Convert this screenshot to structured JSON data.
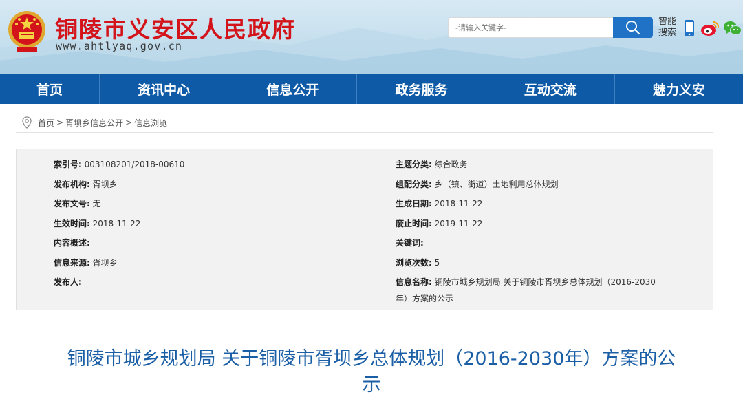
{
  "header": {
    "title": "铜陵市义安区人民政府",
    "url": "www.ahtlyaq.gov.cn",
    "search_placeholder": "-请输入关键字-",
    "smart_search_line1": "智能",
    "smart_search_line2": "搜索",
    "colors": {
      "title_red": "#d4141b",
      "search_blue": "#1f72c6"
    }
  },
  "nav": {
    "items": [
      "首页",
      "资讯中心",
      "信息公开",
      "政务服务",
      "互动交流",
      "魅力义安"
    ],
    "color": "#0e5aa7"
  },
  "breadcrumb": {
    "items": [
      "首页",
      "胥坝乡信息公开",
      "信息浏览"
    ],
    "separator": ">"
  },
  "meta": {
    "left": [
      {
        "key": "索引号:",
        "value": "003108201/2018-00610"
      },
      {
        "key": "发布机构:",
        "value": "胥坝乡"
      },
      {
        "key": "发布文号:",
        "value": "无"
      },
      {
        "key": "生效时间:",
        "value": "2018-11-22"
      },
      {
        "key": "内容概述:",
        "value": ""
      },
      {
        "key": "信息来源:",
        "value": "胥坝乡"
      },
      {
        "key": "发布人:",
        "value": ""
      }
    ],
    "right": [
      {
        "key": "主题分类:",
        "value": "综合政务"
      },
      {
        "key": "组配分类:",
        "value": "乡（镇、街道）土地利用总体规划"
      },
      {
        "key": "生成日期:",
        "value": "2018-11-22"
      },
      {
        "key": "废止时间:",
        "value": "2019-11-22"
      },
      {
        "key": "关键词:",
        "value": ""
      },
      {
        "key": "浏览次数:",
        "value": "5"
      }
    ],
    "name_key": "信息名称:",
    "name_value": "铜陵市城乡规划局 关于铜陵市胥坝乡总体规划（2016-2030年）方案的公示"
  },
  "article": {
    "title_line1": "铜陵市城乡规划局 关于铜陵市胥坝乡总体规划（2016-2030年）方案的公",
    "title_line2": "示",
    "title_color": "#1a5ea6"
  },
  "icons": [
    "national-emblem-icon",
    "search-icon",
    "mobile-icon",
    "weibo-icon",
    "wechat-icon",
    "location-pin-icon"
  ]
}
